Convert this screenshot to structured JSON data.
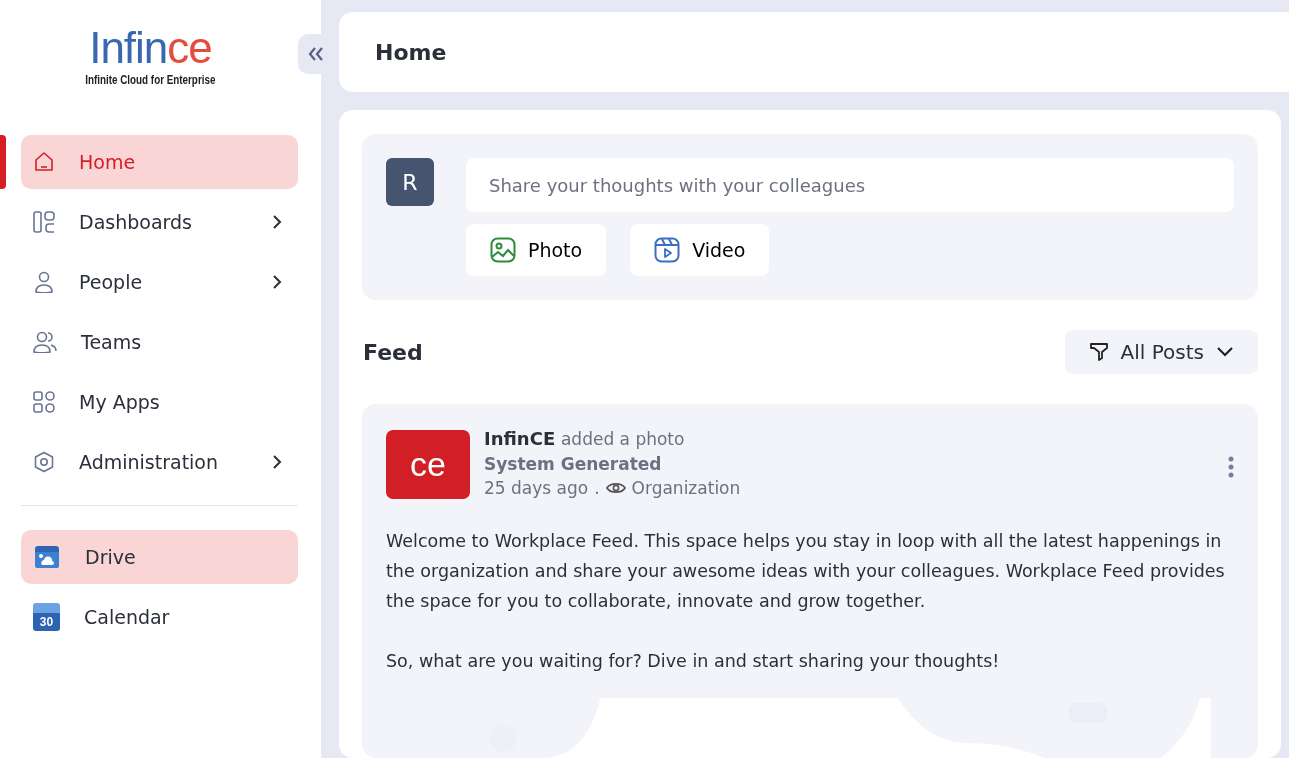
{
  "logo": {
    "name_main": "Infin",
    "name_accent": "ce",
    "tagline": "Infinite Cloud for Enterprise"
  },
  "sidebar": {
    "items": [
      {
        "label": "Home",
        "selected": true,
        "hovered": false,
        "has_submenu": false
      },
      {
        "label": "Dashboards",
        "selected": false,
        "hovered": false,
        "has_submenu": true
      },
      {
        "label": "People",
        "selected": false,
        "hovered": false,
        "has_submenu": true
      },
      {
        "label": "Teams",
        "selected": false,
        "hovered": false,
        "has_submenu": false
      },
      {
        "label": "My Apps",
        "selected": false,
        "hovered": false,
        "has_submenu": false
      },
      {
        "label": "Administration",
        "selected": false,
        "hovered": false,
        "has_submenu": true
      }
    ],
    "apps": [
      {
        "label": "Drive",
        "kind": "drive",
        "selected": false,
        "hovered": true
      },
      {
        "label": "Calendar",
        "kind": "calendar",
        "selected": false,
        "hovered": false,
        "icon_text": "30"
      }
    ]
  },
  "header": {
    "title": "Home"
  },
  "composer": {
    "avatar": "R",
    "placeholder": "Share your thoughts with your colleagues",
    "buttons": [
      {
        "label": "Photo"
      },
      {
        "label": "Video",
        "kind": "video"
      }
    ]
  },
  "feed": {
    "title": "Feed",
    "filter": "All Posts"
  },
  "post": {
    "avatar_text": "ce",
    "author": "InfinCE",
    "action": "added a photo",
    "subtitle": "System Generated",
    "time": "25 days ago",
    "separator": ".",
    "visibility": "Organization",
    "paragraphs": [
      "Welcome to Workplace Feed. This space helps you stay in loop with all the latest happenings in the organization and share your awesome ideas with your colleagues. Workplace Feed provides the space for you to collaborate, innovate and grow together.",
      "So, what are you waiting for? Dive in and start sharing your thoughts!"
    ]
  }
}
